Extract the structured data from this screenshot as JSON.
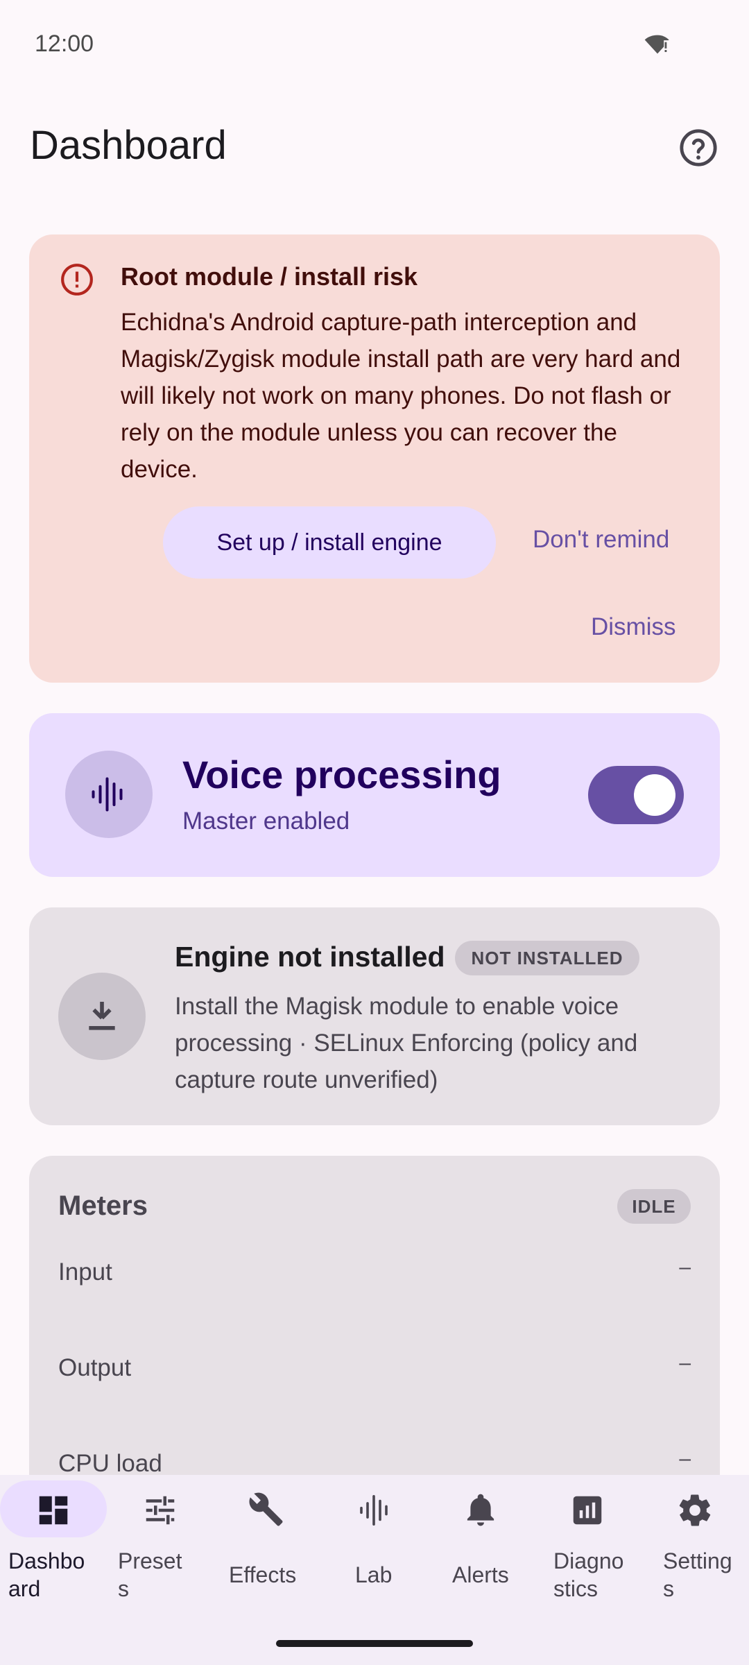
{
  "status_bar": {
    "time": "12:00",
    "wifi_icon": "wifi-alert-icon"
  },
  "header": {
    "title": "Dashboard",
    "help_icon": "help-circle-icon"
  },
  "risk_card": {
    "icon": "error-icon",
    "title": "Root module / install risk",
    "body": "Echidna's Android capture-path interception and Magisk/Zygisk module install path are very hard and will likely not work on many phones. Do not flash or rely on the module unless you can recover the device.",
    "primary_label": "Set up / install engine",
    "remind_label": "Don't remind",
    "dismiss_label": "Dismiss"
  },
  "voice_card": {
    "icon": "waveform-icon",
    "title": "Voice processing",
    "subtitle": "Master enabled",
    "enabled": true
  },
  "engine_card": {
    "icon": "download-icon",
    "title": "Engine not installed",
    "badge": "NOT INSTALLED",
    "body": "Install the Magisk module to enable voice processing · SELinux Enforcing (policy and capture route unverified)"
  },
  "meters": {
    "title": "Meters",
    "badge": "IDLE",
    "rows": [
      {
        "label": "Input",
        "value": "–"
      },
      {
        "label": "Output",
        "value": "–"
      },
      {
        "label": "CPU load",
        "value": "–"
      }
    ]
  },
  "nav": {
    "items": [
      {
        "label": "Dashbo\nard",
        "icon": "dashboard-icon",
        "active": true
      },
      {
        "label": "Preset\ns",
        "icon": "tune-icon",
        "active": false
      },
      {
        "label": "Effects",
        "icon": "wrench-icon",
        "active": false
      },
      {
        "label": "Lab",
        "icon": "waveform-icon",
        "active": false
      },
      {
        "label": "Alerts",
        "icon": "bell-icon",
        "active": false
      },
      {
        "label": "Diagno\nstics",
        "icon": "chart-icon",
        "active": false
      },
      {
        "label": "Setting\ns",
        "icon": "gear-icon",
        "active": false
      }
    ]
  },
  "colors": {
    "accent": "#6750a4",
    "risk_bg": "#f8dcd8",
    "voice_bg": "#eaddff",
    "card_bg": "#e7e1e6",
    "nav_bg": "#f3edf7"
  }
}
